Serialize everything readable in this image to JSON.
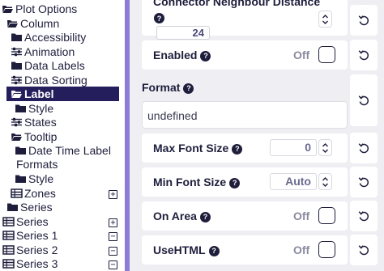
{
  "tree": {
    "items": [
      {
        "label": "Plot Options",
        "icon": "folder-open-icon"
      },
      {
        "label": "Column",
        "icon": "folder-open-icon"
      },
      {
        "label": "Accessibility",
        "icon": "folder-icon"
      },
      {
        "label": "Animation",
        "icon": "sliders-icon"
      },
      {
        "label": "Data Labels",
        "icon": "folder-icon"
      },
      {
        "label": "Data Sorting",
        "icon": "sliders-icon"
      },
      {
        "label": "Label",
        "icon": "folder-open-icon"
      },
      {
        "label": "Style",
        "icon": "folder-icon"
      },
      {
        "label": "States",
        "icon": "sliders-icon"
      },
      {
        "label": "Tooltip",
        "icon": "folder-open-icon"
      },
      {
        "label": "Date Time Label",
        "icon": "folder-icon"
      },
      {
        "label": "Formats",
        "icon": ""
      },
      {
        "label": "Style",
        "icon": "folder-icon"
      },
      {
        "label": "Zones",
        "icon": "table-icon"
      },
      {
        "label": "Series",
        "icon": "folder-icon"
      },
      {
        "label": "Series",
        "icon": "table-icon"
      },
      {
        "label": "Series 1",
        "icon": "table-icon"
      },
      {
        "label": "Series 2",
        "icon": "table-icon"
      },
      {
        "label": "Series 3",
        "icon": "table-icon"
      }
    ],
    "toggles": {
      "zones": "+",
      "series": "+",
      "series1": "−",
      "series2": "−",
      "series3": "−"
    }
  },
  "panel": {
    "connector_distance": {
      "label": "Connector Neighbour Distance",
      "value": "24"
    },
    "enabled": {
      "label": "Enabled",
      "state": "Off"
    },
    "format": {
      "label": "Format",
      "value": "undefined"
    },
    "max_font_size": {
      "label": "Max Font Size",
      "value": "0"
    },
    "min_font_size": {
      "label": "Min Font Size",
      "value": "Auto"
    },
    "on_area": {
      "label": "On Area",
      "state": "Off"
    },
    "use_html": {
      "label": "UseHTML",
      "state": "Off"
    }
  },
  "colors": {
    "selected_bg": "#241f5c",
    "divider": "#8e7bd6",
    "panel_bg": "#efeff3",
    "text": "#1e1e3c"
  }
}
